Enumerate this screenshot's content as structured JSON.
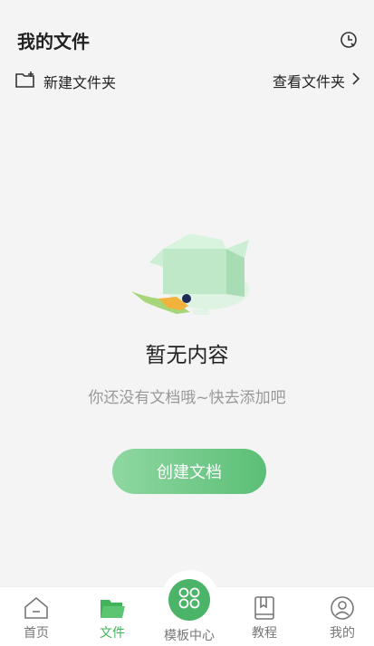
{
  "header": {
    "title": "我的文件",
    "history_icon": "clock-history-icon"
  },
  "actions": {
    "new_folder_label": "新建文件夹",
    "new_folder_icon": "folder-plus-icon",
    "view_folder_label": "查看文件夹",
    "view_folder_icon": "chevron-right-icon"
  },
  "empty_state": {
    "illustration": "open-box-person-illustration",
    "title": "暂无内容",
    "subtitle": "你还没有文档哦~快去添加吧",
    "button_label": "创建文档"
  },
  "tabbar": {
    "items": [
      {
        "label": "首页",
        "icon": "home-icon",
        "active": false
      },
      {
        "label": "文件",
        "icon": "folder-icon",
        "active": true
      },
      {
        "label": "模板中心",
        "icon": "grid-apps-icon",
        "active": false
      },
      {
        "label": "教程",
        "icon": "book-icon",
        "active": false
      },
      {
        "label": "我的",
        "icon": "user-icon",
        "active": false
      }
    ]
  },
  "colors": {
    "accent": "#41b35a",
    "button_gradient_start": "#8fd7a2",
    "button_gradient_end": "#5bbf76",
    "background": "#f4f4f4"
  }
}
